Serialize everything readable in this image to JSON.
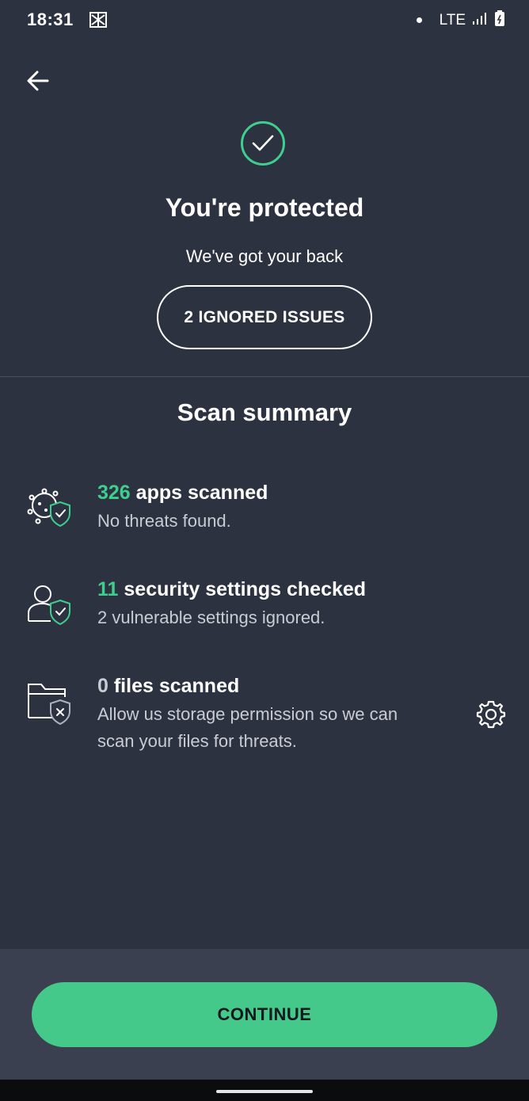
{
  "status_bar": {
    "time": "18:31",
    "network": "LTE",
    "icons": [
      "notification-icon",
      "dot-icon",
      "signal-icon",
      "battery-icon"
    ]
  },
  "header": {
    "back_icon": "arrow-left-icon"
  },
  "hero": {
    "status_icon": "check-circle-icon",
    "title": "You're protected",
    "subtitle": "We've got your back",
    "ignored_button_label": "2 IGNORED ISSUES"
  },
  "summary": {
    "title": "Scan summary",
    "items": [
      {
        "icon": "virus-shield-icon",
        "count": "326",
        "label": " apps scanned",
        "description": "No threats found."
      },
      {
        "icon": "user-shield-icon",
        "count": "11",
        "label": " security settings checked",
        "description": "2 vulnerable settings ignored."
      },
      {
        "icon": "folder-x-icon",
        "count": "0",
        "label": " files scanned",
        "description": "Allow us storage permission so we can scan your files for threats.",
        "action_icon": "gear-icon"
      }
    ]
  },
  "footer": {
    "continue_label": "CONTINUE"
  },
  "colors": {
    "background": "#2d3240",
    "accent": "#3ecf8e",
    "button": "#44c98a",
    "bottom_bar": "#3a404f"
  }
}
